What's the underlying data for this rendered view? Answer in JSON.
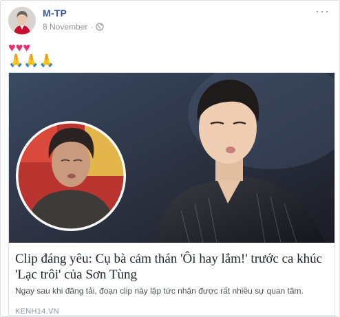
{
  "post": {
    "author": "M-TP",
    "date": "8 November",
    "date_separator": "·",
    "more_icon_glyph": "···",
    "text_line1": "♥♥♥",
    "text_line2": "🙏🙏🙏",
    "icons": {
      "privacy": "globe-icon",
      "more": "more-options-icon",
      "heart": "heart-emoji-icon",
      "pray": "folded-hands-emoji-icon"
    }
  },
  "link_card": {
    "title": "Clip đáng yêu: Cụ bà cảm thán 'Ôi hay lắm!' trước ca khúc 'Lạc trôi' của Sơn Tùng",
    "description": "Ngay sau khi đăng tải, đoạn clip này lập tức nhận được rất nhiều sự quan tâm.",
    "domain": "KENH14.VN"
  },
  "colors": {
    "author_link": "#385898",
    "secondary_text": "#90949c",
    "heart": "#e8306e",
    "border": "#dddfe2"
  }
}
